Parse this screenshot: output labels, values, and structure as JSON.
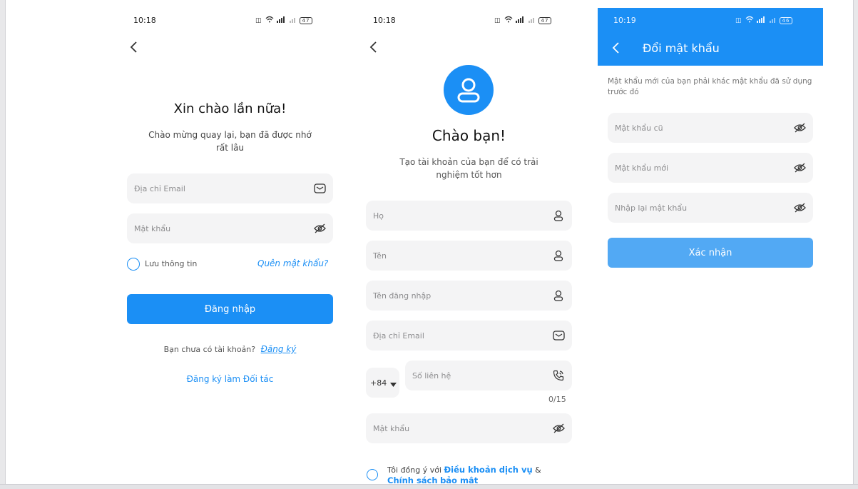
{
  "colors": {
    "accent": "#1b8ff5",
    "field_bg": "#f4f4f5",
    "header_bg": "#1b8ff5"
  },
  "login": {
    "status": {
      "time": "10:18",
      "battery": "47"
    },
    "title": "Xin chào lần nữa!",
    "subtitle_line1": "Chào mừng quay lại, bạn đã được nhớ",
    "subtitle_line2": "rất lâu",
    "email_placeholder": "Địa chỉ Email",
    "password_placeholder": "Mật khẩu",
    "remember_label": "Lưu thông tin",
    "forgot_label": "Quên mật khẩu?",
    "login_button": "Đăng nhập",
    "no_account_text": "Bạn chưa có tài khoản?",
    "register_link": "Đăng ký",
    "partner_link": "Đăng ký làm Đối tác"
  },
  "register": {
    "status": {
      "time": "10:18",
      "battery": "47"
    },
    "title": "Chào bạn!",
    "subtitle_line1": "Tạo tài khoản của bạn để có trải",
    "subtitle_line2": "nghiệm tốt hơn",
    "last_name_placeholder": "Họ",
    "first_name_placeholder": "Tên",
    "username_placeholder": "Tên đăng nhập",
    "email_placeholder": "Địa chỉ Email",
    "country_code": "+84",
    "phone_placeholder": "Số liên hệ",
    "phone_counter": "0/15",
    "password_placeholder": "Mật khẩu",
    "agree_prefix": "Tôi đồng ý với",
    "terms_link": "Điều khoản dịch vụ",
    "and_text": "&",
    "policy_link": "Chính sách",
    "policy_link_line2": "bảo mật"
  },
  "change_password": {
    "status": {
      "time": "10:19",
      "battery": "46"
    },
    "title": "Đổi mật khẩu",
    "note_line1": "Mật khẩu mới của bạn phải khác mật khẩu đã sử dụng",
    "note_line2": "trước đó",
    "old_password_placeholder": "Mật khẩu cũ",
    "new_password_placeholder": "Mật khẩu mới",
    "confirm_password_placeholder": "Nhập lại mật khẩu",
    "confirm_button": "Xác nhận"
  },
  "icons": [
    "back-icon",
    "mail-icon",
    "eye-off-icon",
    "user-icon",
    "phone-icon",
    "chevron-down-icon",
    "avatar-icon",
    "wifi-icon",
    "signal-icon",
    "battery-icon"
  ]
}
